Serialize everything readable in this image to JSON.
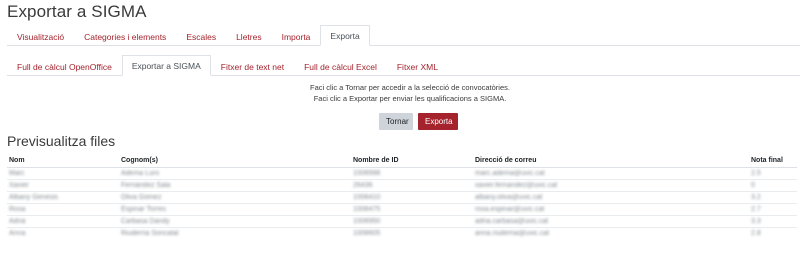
{
  "page": {
    "title": "Exportar a SIGMA"
  },
  "primary_tabs": [
    {
      "label": "Visualització",
      "active": false
    },
    {
      "label": "Categories i elements",
      "active": false
    },
    {
      "label": "Escales",
      "active": false
    },
    {
      "label": "Lletres",
      "active": false
    },
    {
      "label": "Importa",
      "active": false
    },
    {
      "label": "Exporta",
      "active": true
    }
  ],
  "secondary_tabs": [
    {
      "label": "Full de càlcul OpenOffice",
      "active": false
    },
    {
      "label": "Exportar a SIGMA",
      "active": true
    },
    {
      "label": "Fitxer de text net",
      "active": false
    },
    {
      "label": "Full de càlcul Excel",
      "active": false
    },
    {
      "label": "Fitxer XML",
      "active": false
    }
  ],
  "instructions": {
    "line1": "Faci clic a Tornar per accedir a la selecció de convocatòries.",
    "line2": "Faci clic a Exportar per enviar les qualificacions a SIGMA."
  },
  "buttons": {
    "back": "Tornar",
    "export": "Exporta"
  },
  "preview": {
    "title": "Previsualitza files",
    "headers": [
      "Nom",
      "Cognom(s)",
      "Nombre de ID",
      "Direcció de correu",
      "Nota final"
    ],
    "rows": [
      [
        "Marc",
        "Adema Luro",
        "1008998",
        "marc.adema@uvic.cat",
        "2.5"
      ],
      [
        "Xavier",
        "Fernández Sala",
        "26436",
        "xavier.fernandez@uvic.cat",
        "0"
      ],
      [
        "Albany Genesis",
        "Oliva Gómez",
        "1008410",
        "albany.oliva@uvic.cat",
        "3.2"
      ],
      [
        "Rosa",
        "Espinar Torres",
        "1008475",
        "rosa.espinar@uvic.cat",
        "2.7"
      ],
      [
        "Adrià",
        "Carbasa Dandy",
        "1008950",
        "adria.carbasa@uvic.cat",
        "3.3"
      ],
      [
        "Anna",
        "Riuderria Soncatal",
        "1008605",
        "anna.riuderria@uvic.cat",
        "2.8"
      ]
    ]
  }
}
